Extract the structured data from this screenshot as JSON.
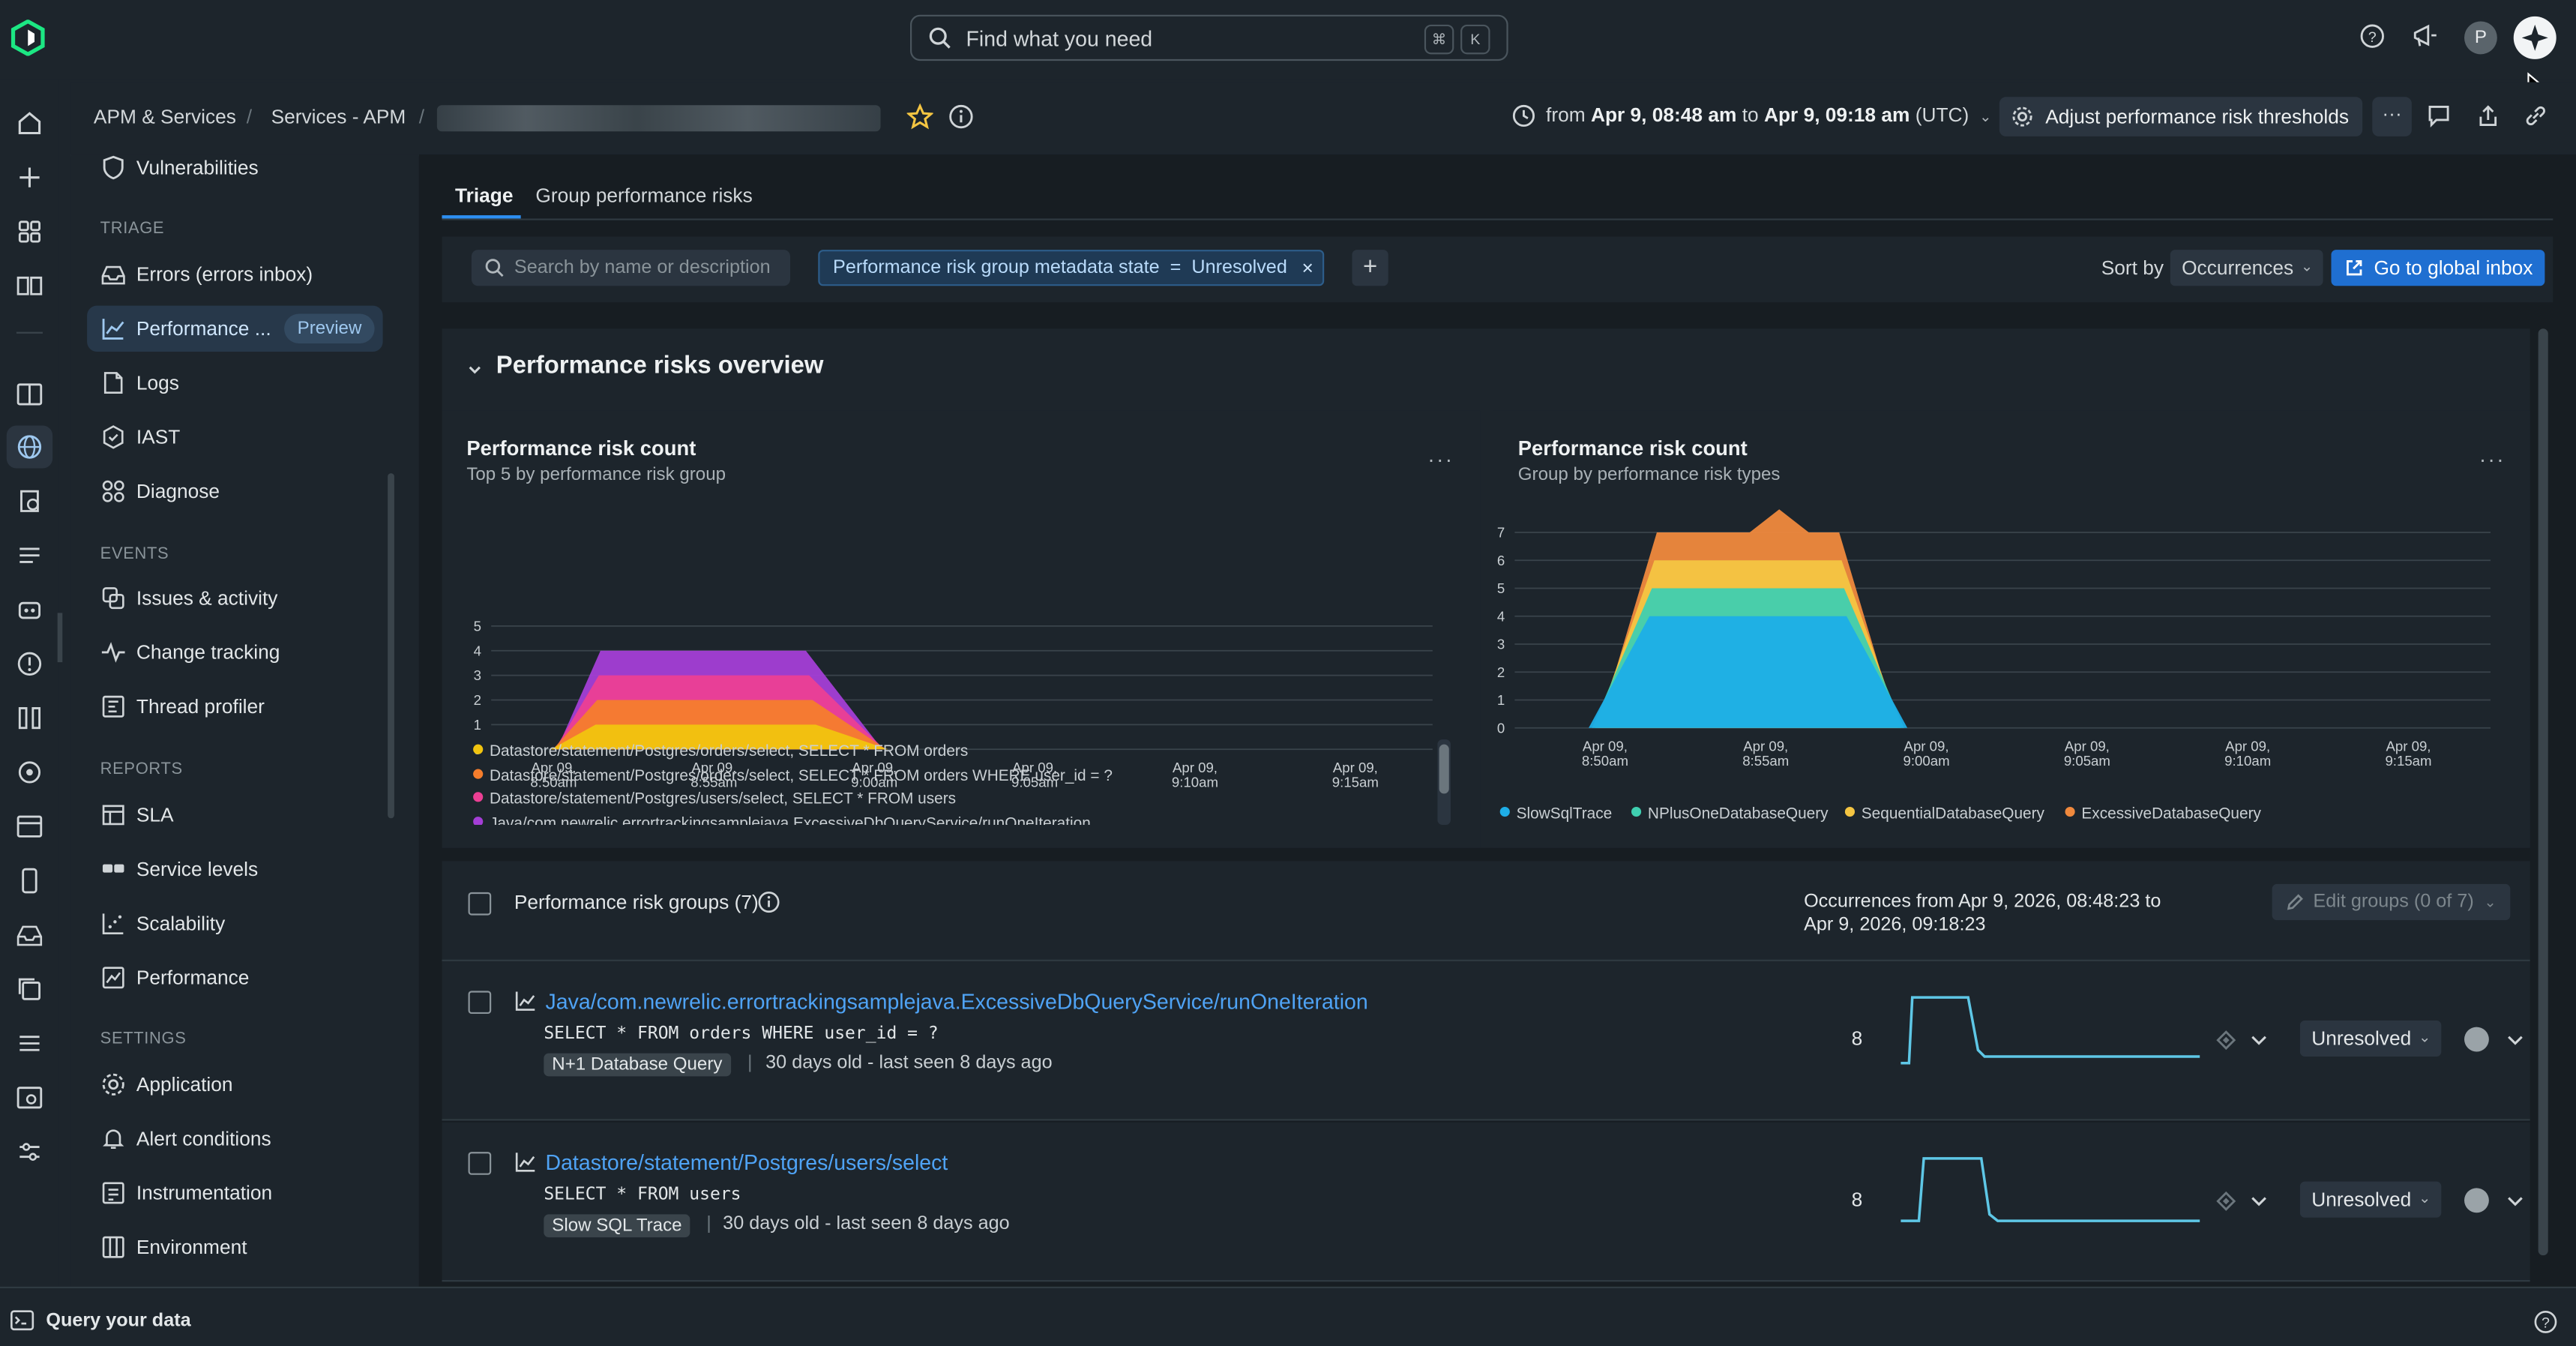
{
  "search": {
    "placeholder": "Find what you need",
    "kbd1": "⌘",
    "kbd2": "K"
  },
  "user": {
    "initial": "P"
  },
  "breadcrumb": {
    "items": [
      "APM & Services",
      "Services - APM"
    ],
    "sep": "/"
  },
  "time_range": {
    "prefix": "from",
    "from": "Apr 9, 08:48 am",
    "to_word": "to",
    "to": "Apr 9, 09:18 am",
    "tz": "(UTC)"
  },
  "header": {
    "thresholds_label": "Adjust performance risk thresholds"
  },
  "nav": {
    "top_item": "Vulnerabilities",
    "sections": [
      {
        "title": "TRIAGE",
        "items": [
          "Errors (errors inbox)",
          "Performance ...",
          "Logs",
          "IAST",
          "Diagnose"
        ]
      },
      {
        "title": "EVENTS",
        "items": [
          "Issues & activity",
          "Change tracking",
          "Thread profiler"
        ]
      },
      {
        "title": "REPORTS",
        "items": [
          "SLA",
          "Service levels",
          "Scalability",
          "Performance"
        ]
      },
      {
        "title": "SETTINGS",
        "items": [
          "Application",
          "Alert conditions",
          "Instrumentation",
          "Environment"
        ]
      }
    ],
    "preview_badge": "Preview"
  },
  "tabs": [
    "Triage",
    "Group performance risks"
  ],
  "filters": {
    "search_placeholder": "Search by name or description",
    "chip_field": "Performance risk group metadata state",
    "chip_op": "=",
    "chip_value": "Unresolved",
    "chip_remove": "×",
    "add": "+"
  },
  "sort": {
    "label": "Sort by",
    "value": "Occurrences"
  },
  "global_inbox": "Go to global inbox",
  "overview": {
    "title": "Performance risks overview"
  },
  "chart_data": [
    {
      "type": "area",
      "title": "Performance risk count",
      "subtitle": "Top 5 by performance risk group",
      "x": [
        "Apr 09, 8:50am",
        "Apr 09, 8:55am",
        "Apr 09, 9:00am",
        "Apr 09, 9:05am",
        "Apr 09, 9:10am",
        "Apr 09, 9:15am"
      ],
      "ylim": [
        0,
        5
      ],
      "yticks": [
        "5",
        "4",
        "3",
        "2",
        "1",
        "0"
      ],
      "series": [
        {
          "name": "Datastore/statement/Postgres/orders/select, SELECT * FROM orders",
          "color": "#f1c40f"
        },
        {
          "name": "Datastore/statement/Postgres/orders/select, SELECT * FROM orders WHERE user_id = ?",
          "color": "#f57d2c"
        },
        {
          "name": "Datastore/statement/Postgres/users/select, SELECT * FROM users",
          "color": "#ec3f94"
        },
        {
          "name": "Java/com.newrelic.errortrackingsamplejava.ExcessiveDbQueryService/runOneIteration",
          "color": "#a43ed6"
        }
      ],
      "stack_peak_per_series": 1,
      "legend": "bottom"
    },
    {
      "type": "area",
      "title": "Performance risk count",
      "subtitle": "Group by performance risk types",
      "x": [
        "Apr 09, 8:50am",
        "Apr 09, 8:55am",
        "Apr 09, 9:00am",
        "Apr 09, 9:05am",
        "Apr 09, 9:10am",
        "Apr 09, 9:15am"
      ],
      "ylim": [
        0,
        7
      ],
      "yticks": [
        "7",
        "6",
        "5",
        "4",
        "3",
        "2",
        "1",
        "0"
      ],
      "series": [
        {
          "name": "SlowSqlTrace",
          "color": "#1eaee7",
          "peak": 4
        },
        {
          "name": "NPlusOneDatabaseQuery",
          "color": "#3fcfb0",
          "peak": 1
        },
        {
          "name": "SequentialDatabaseQuery",
          "color": "#f4c542",
          "peak": 1
        },
        {
          "name": "ExcessiveDatabaseQuery",
          "color": "#f0893d",
          "peak": 1
        }
      ],
      "legend": "bottom"
    }
  ],
  "groups": {
    "title": "Performance risk groups (7)",
    "occurrences_line1": "Occurrences from Apr 9, 2026, 08:48:23 to",
    "occurrences_line2": "Apr 9, 2026, 09:18:23",
    "edit": "Edit groups (0 of 7)",
    "rows": [
      {
        "title": "Java/com.newrelic.errortrackingsamplejava.ExcessiveDbQueryService/runOneIteration",
        "query": "SELECT * FROM orders WHERE user_id = ?",
        "tag": "N+1 Database Query",
        "sep": "|",
        "age": "30 days old - last seen 8 days ago",
        "count": "8",
        "status": "Unresolved"
      },
      {
        "title": "Datastore/statement/Postgres/users/select",
        "query": "SELECT * FROM users",
        "tag": "Slow SQL Trace",
        "sep": "|",
        "age": "30 days old - last seen 8 days ago",
        "count": "8",
        "status": "Unresolved"
      }
    ]
  },
  "bottom": {
    "label": "Query your data"
  }
}
